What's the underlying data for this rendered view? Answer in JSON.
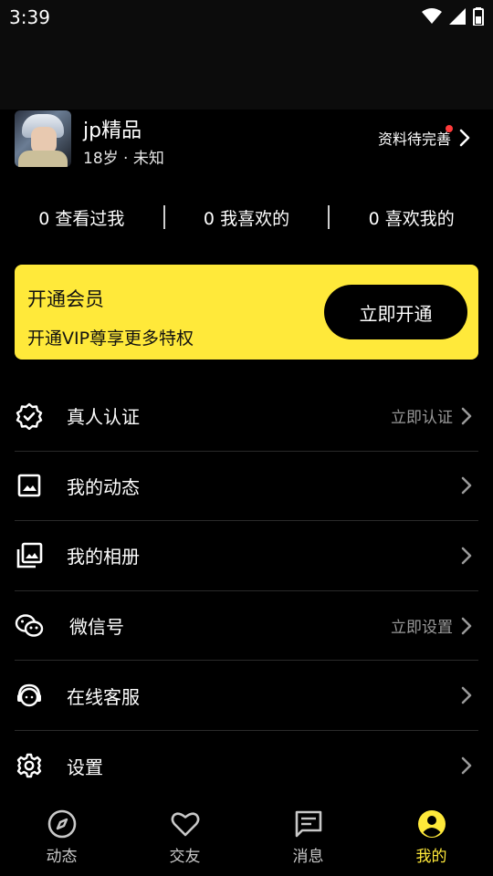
{
  "status": {
    "time": "3:39",
    "icons": [
      "wifi-icon",
      "signal-icon",
      "battery-icon"
    ]
  },
  "profile": {
    "name": "jp精品",
    "meta": "18岁 · 未知",
    "complete_label": "资料待完善"
  },
  "stats": [
    {
      "count": "0",
      "label": "查看过我"
    },
    {
      "count": "0",
      "label": "我喜欢的"
    },
    {
      "count": "0",
      "label": "喜欢我的"
    }
  ],
  "vip": {
    "title": "开通会员",
    "subtitle": "开通VIP尊享更多特权",
    "button": "立即开通",
    "color": "#ffe93a"
  },
  "menu": [
    {
      "icon": "verified-badge-icon",
      "label": "真人认证",
      "right": "立即认证"
    },
    {
      "icon": "image-icon",
      "label": "我的动态",
      "right": ""
    },
    {
      "icon": "photo-album-icon",
      "label": "我的相册",
      "right": ""
    },
    {
      "icon": "wechat-icon",
      "label": "微信号",
      "right": "立即设置"
    },
    {
      "icon": "headset-icon",
      "label": "在线客服",
      "right": ""
    },
    {
      "icon": "gear-icon",
      "label": "设置",
      "right": ""
    }
  ],
  "bottom_nav": [
    {
      "icon": "compass-icon",
      "label": "动态",
      "active": false
    },
    {
      "icon": "heart-icon",
      "label": "交友",
      "active": false
    },
    {
      "icon": "message-icon",
      "label": "消息",
      "active": false
    },
    {
      "icon": "profile-icon",
      "label": "我的",
      "active": true
    }
  ],
  "colors": {
    "accent": "#ffe93a",
    "background": "#000000",
    "notification_dot": "#ff3b3b"
  }
}
